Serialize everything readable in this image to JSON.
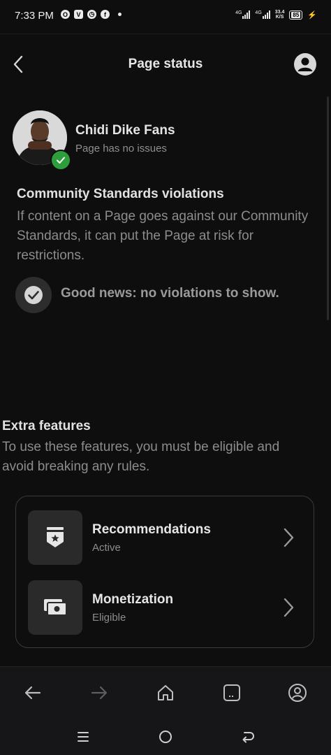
{
  "status_bar": {
    "time": "7:33 PM",
    "network_1": "4G",
    "network_2": "4G",
    "speed_value": "33.4",
    "speed_unit": "K/S",
    "battery": "85"
  },
  "header": {
    "title": "Page status"
  },
  "page": {
    "name": "Chidi Dike Fans",
    "status": "Page has no issues"
  },
  "community_standards": {
    "title": "Community Standards violations",
    "description": "If content on a Page goes against our Community Standards, it can put the Page at risk for restrictions.",
    "good_news": "Good news: no violations to show."
  },
  "extra_features": {
    "title": "Extra features",
    "description": "To use these features, you must be eligible and avoid breaking any rules.",
    "items": [
      {
        "title": "Recommendations",
        "status": "Active",
        "icon": "badge-star-icon"
      },
      {
        "title": "Monetization",
        "status": "Eligible",
        "icon": "cash-icon"
      }
    ]
  },
  "colors": {
    "background": "#0e0e0e",
    "verified_green": "#2e9e3c",
    "card_border": "#3a3a3a"
  }
}
